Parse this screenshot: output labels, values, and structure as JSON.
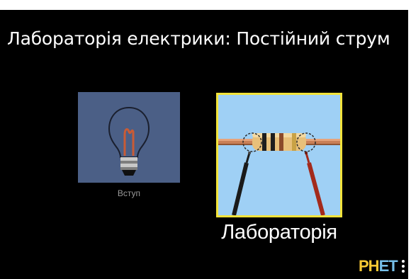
{
  "sim": {
    "title": "Лабораторія електрики: Постійний струм"
  },
  "screens": [
    {
      "label": "Вступ",
      "selected": false
    },
    {
      "label": "Лабораторія",
      "selected": true
    }
  ],
  "logo": {
    "text_ph": "PH",
    "text_et": "ET"
  },
  "colors": {
    "background": "#000000",
    "selected_border": "#f2e33a",
    "intro_thumb": "#4b5f86",
    "lab_thumb": "#9fd0f5",
    "logo_yellow": "#f7c933",
    "logo_blue": "#76bfe8"
  },
  "icons": {
    "intro": "light-bulb-icon",
    "lab": "resistor-with-probes-icon",
    "menu": "vertical-dots-icon"
  }
}
